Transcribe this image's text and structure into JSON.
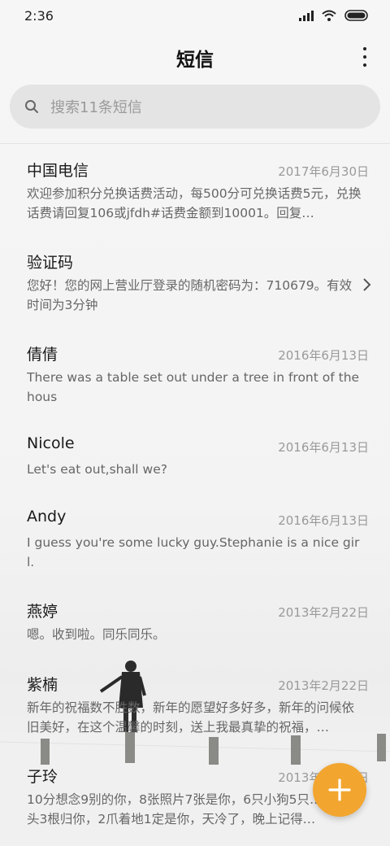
{
  "status_bar": {
    "time": "2:36",
    "icons": [
      "signal-icon",
      "wifi-icon",
      "battery-icon"
    ]
  },
  "header": {
    "title": "短信",
    "more_icon": "more-vertical-icon"
  },
  "search": {
    "placeholder": "搜索11条短信",
    "icon": "search-icon"
  },
  "conversations": [
    {
      "name": "中国电信",
      "date": "2017年6月30日",
      "preview": "欢迎参加积分兑换话费活动，每500分可兑换话费5元，兑换话费请回复106或jfdh#话费金额到10001。回复…"
    },
    {
      "name": "验证码",
      "date": "",
      "preview": "您好！您的网上营业厅登录的随机密码为：710679。有效时间为3分钟",
      "chevron": "chevron-right-icon"
    },
    {
      "name": "倩倩",
      "date": "2016年6月13日",
      "preview": "There was a table set out under a tree in front of the hous"
    },
    {
      "name": "Nicole",
      "date": "2016年6月13日",
      "preview": "Let's eat out,shall we?"
    },
    {
      "name": "Andy",
      "date": "2016年6月13日",
      "preview": "I guess you're some lucky guy.Stephanie is a nice girl."
    },
    {
      "name": "燕婷",
      "date": "2013年2月22日",
      "preview": "嗯。收到啦。同乐同乐。"
    },
    {
      "name": "紫楠",
      "date": "2013年2月22日",
      "preview": "新年的祝福数不胜数，新年的愿望好多好多，新年的问候依旧美好，在这个温馨的时刻，送上我最真挚的祝福，…"
    },
    {
      "name": "子玲",
      "date": "2013年2月22日",
      "preview": "10分想念9别的你，8张照片7张是你，6只小狗5只…4根骨头3根归你，2爪着地1定是你，天冷了，晚上记得…"
    }
  ],
  "fab": {
    "icon": "plus-icon"
  },
  "colors": {
    "accent": "#f2a52f",
    "background": "#f4f4f4",
    "search_bg": "#e4e4e4"
  }
}
